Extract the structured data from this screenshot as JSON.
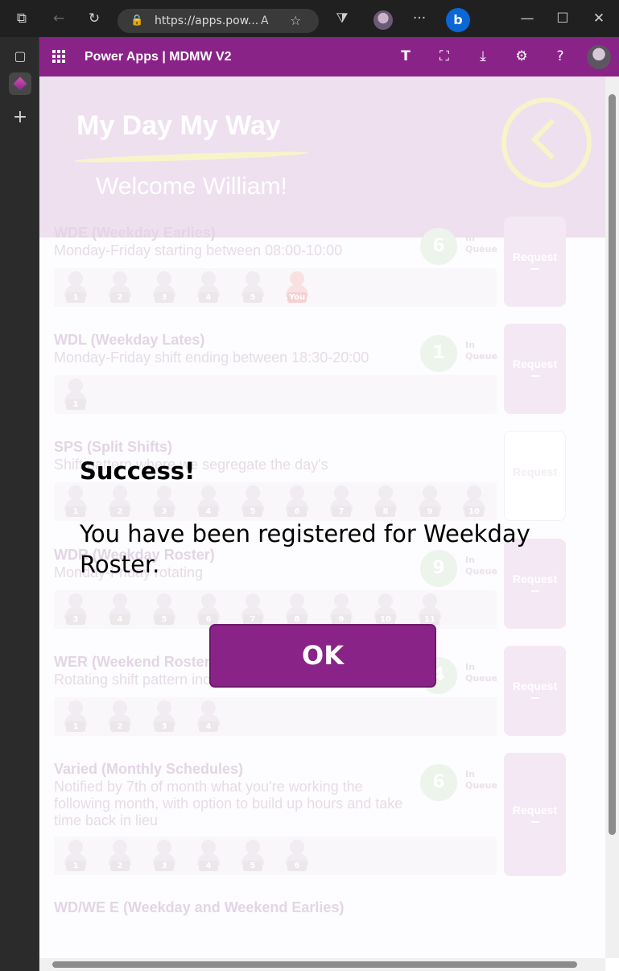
{
  "browser": {
    "url": "https://apps.pow...",
    "buttons": {
      "tabs": "⧉",
      "back": "←",
      "refresh": "↻",
      "lock": "🔒",
      "read_aloud": "A",
      "favorite": "☆",
      "extensions": "⧩",
      "more": "···",
      "bing": "b",
      "minimize": "—",
      "maximize": "☐",
      "close": "✕"
    },
    "sidebar": {
      "tabs_icon": "▢",
      "add": "+"
    }
  },
  "app_header": {
    "title": "Power Apps  |  MDMW V2",
    "icons": [
      "teams-icon",
      "fit-screen-icon",
      "download-icon",
      "settings-icon",
      "help-icon"
    ],
    "icon_glyphs": {
      "teams": "T",
      "fit": "⛶",
      "download": "⤓",
      "settings": "⚙",
      "help": "?"
    }
  },
  "hero": {
    "title": "My Day My Way",
    "welcome": "Welcome William!"
  },
  "cards": [
    {
      "title": "WDE (Weekday Earlies)",
      "desc": "Monday-Friday starting between 08:00-10:00",
      "queue": "6",
      "queue_label": "In Queue",
      "button": "Request",
      "people": [
        "1",
        "2",
        "3",
        "4",
        "5",
        "You"
      ]
    },
    {
      "title": "WDL (Weekday Lates)",
      "desc": "Monday-Friday shift ending between 18:30-20:00",
      "queue": "1",
      "queue_label": "In Queue",
      "button": "Request",
      "people": [
        "1"
      ]
    },
    {
      "title": "SPS (Split Shifts)",
      "desc": "Shift pattern where we segregate the day's",
      "queue": "",
      "queue_label": "",
      "button": "Request",
      "people": [
        "1",
        "2",
        "3",
        "4",
        "5",
        "6",
        "7",
        "8",
        "9",
        "10"
      ]
    },
    {
      "title": "WDR (Weekday Roster)",
      "desc": "Monday-Friday rotating",
      "queue": "9",
      "queue_label": "In Queue",
      "button": "Request",
      "people": [
        "3",
        "4",
        "5",
        "6",
        "7",
        "8",
        "9",
        "10",
        "11"
      ]
    },
    {
      "title": "WER (Weekend Roster)",
      "desc": "Rotating shift pattern including some weekend shifts",
      "queue": "4",
      "queue_label": "In Queue",
      "button": "Request",
      "people": [
        "1",
        "2",
        "3",
        "4"
      ]
    },
    {
      "title": "Varied (Monthly Schedules)",
      "desc": "Notified by 7th of month what you're working the following month, with option to build up hours and take time back in lieu",
      "queue": "6",
      "queue_label": "In Queue",
      "button": "Request",
      "people": [
        "1",
        "2",
        "3",
        "4",
        "5",
        "6"
      ]
    },
    {
      "title": "WD/WE E (Weekday and Weekend Earlies)",
      "desc": "",
      "queue": "",
      "queue_label": "",
      "button": "",
      "people": []
    }
  ],
  "dialog": {
    "title": "Success!",
    "message": "You have been registered for Weekday Roster.",
    "ok_label": "OK"
  }
}
